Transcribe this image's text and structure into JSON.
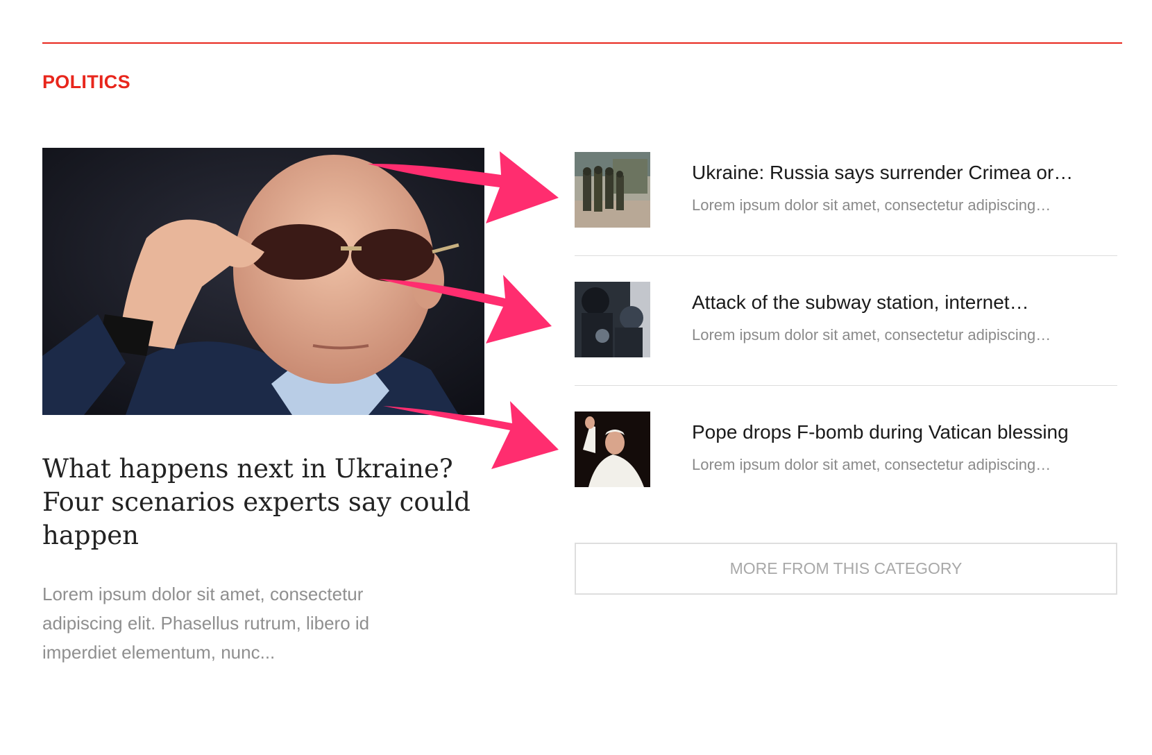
{
  "section": {
    "label": "POLITICS",
    "accent_color": "#e8261c"
  },
  "featured": {
    "title": "What happens next in Ukraine? Four scenarios experts say could happen",
    "excerpt": "Lorem ipsum dolor sit amet, consectetur adipiscing elit. Phasellus rutrum, libero id imperdiet elementum, nunc...",
    "image": "featured-photo"
  },
  "stories": [
    {
      "title": "Ukraine: Russia says surrender Crimea or…",
      "excerpt": "Lorem ipsum dolor sit amet, consectetur adipiscing…",
      "thumbnail": "soldiers-thumbnail"
    },
    {
      "title": "Attack of the subway station, internet…",
      "excerpt": "Lorem ipsum dolor sit amet, consectetur adipiscing…",
      "thumbnail": "police-thumbnail"
    },
    {
      "title": "Pope drops F-bomb during Vatican blessing",
      "excerpt": "Lorem ipsum dolor sit amet, consectetur adipiscing…",
      "thumbnail": "pope-thumbnail"
    }
  ],
  "more_button": {
    "label": "MORE FROM THIS CATEGORY"
  },
  "annotation_arrow_color": "#ff2d6f"
}
